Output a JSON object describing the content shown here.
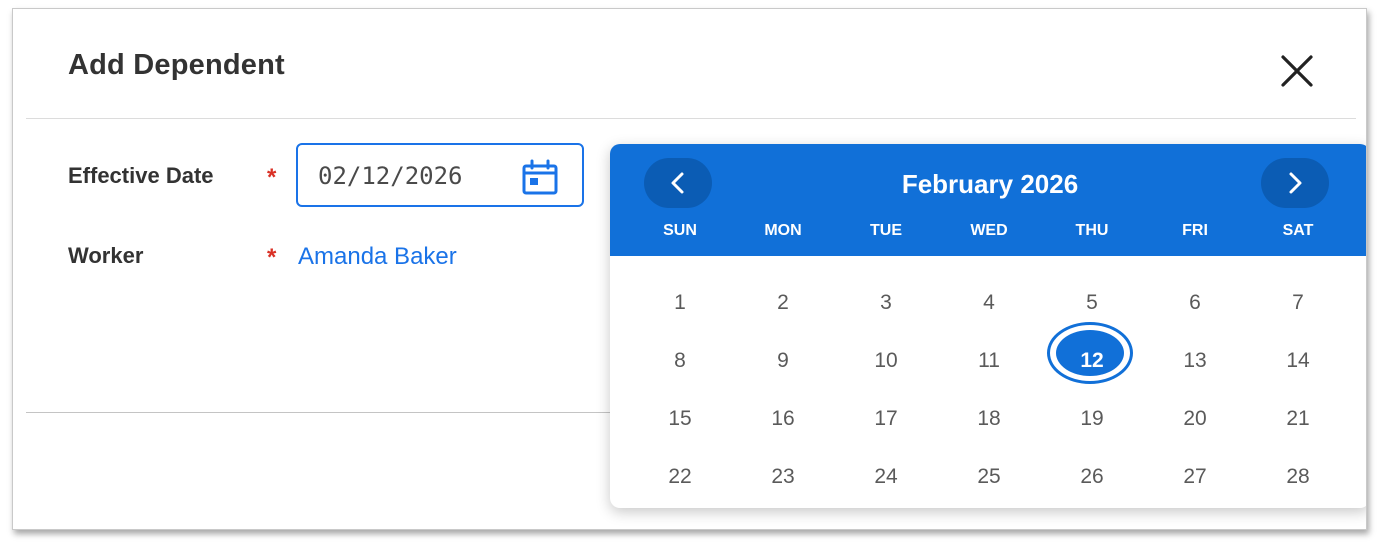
{
  "dialog": {
    "title": "Add Dependent",
    "close_icon": "close-icon"
  },
  "form": {
    "effective_date": {
      "label": "Effective Date",
      "required_mark": "*",
      "value": "02/12/2026",
      "icon": "calendar-icon"
    },
    "worker": {
      "label": "Worker",
      "required_mark": "*",
      "value": "Amanda Baker"
    }
  },
  "calendar": {
    "month_label": "February 2026",
    "prev_icon": "chevron-left-icon",
    "next_icon": "chevron-right-icon",
    "weekdays": [
      "SUN",
      "MON",
      "TUE",
      "WED",
      "THU",
      "FRI",
      "SAT"
    ],
    "weeks": [
      [
        "1",
        "2",
        "3",
        "4",
        "5",
        "6",
        "7"
      ],
      [
        "8",
        "9",
        "10",
        "11",
        "12",
        "13",
        "14"
      ],
      [
        "15",
        "16",
        "17",
        "18",
        "19",
        "20",
        "21"
      ],
      [
        "22",
        "23",
        "24",
        "25",
        "26",
        "27",
        "28"
      ]
    ],
    "selected_day": "12"
  },
  "colors": {
    "accent": "#1170d8",
    "accent_dark": "#0b5cb4",
    "link": "#1a73e8",
    "required": "#d93025"
  }
}
